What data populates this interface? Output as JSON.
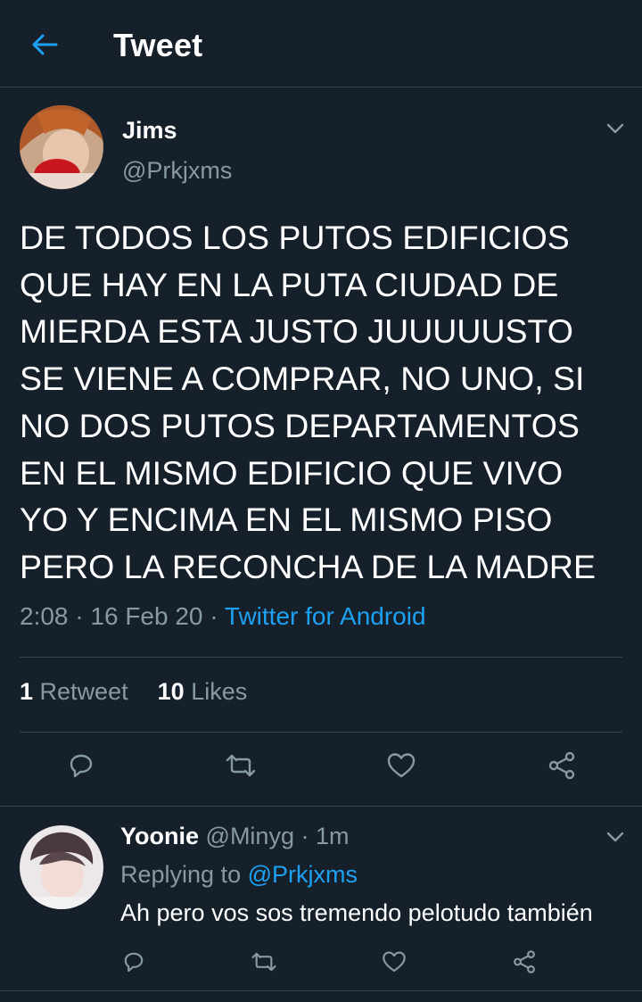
{
  "header": {
    "title": "Tweet"
  },
  "tweet": {
    "name": "Jims",
    "handle": "@Prkjxms",
    "text": "DE TODOS LOS PUTOS EDIFICIOS\nQUE HAY EN LA PUTA CIUDAD DE\nMIERDA ESTA JUSTO JUUUUUSTO\nSE VIENE A COMPRAR, NO UNO, SI\nNO DOS PUTOS DEPARTAMENTOS\nEN EL MISMO EDIFICIO QUE VIVO\nYO Y ENCIMA EN EL MISMO PISO\nPERO LA RECONCHA DE LA MADRE",
    "time": "2:08",
    "date": "16 Feb 20",
    "source": "Twitter for Android",
    "retweet_count": "1",
    "retweet_label": "Retweet",
    "like_count": "10",
    "like_label": "Likes"
  },
  "reply": {
    "name": "Yoonie",
    "handle": "@Minyg",
    "age": "1m",
    "replying_prefix": "Replying to",
    "replying_to": "@Prkjxms",
    "text": "Ah pero vos sos tremendo pelotudo también"
  },
  "colors": {
    "background": "#15202b",
    "accent": "#1da1f2",
    "muted": "#8899a6",
    "divider": "#38444d"
  },
  "icons": [
    "back-arrow-icon",
    "chevron-down-icon",
    "reply-icon",
    "retweet-icon",
    "like-icon",
    "share-icon"
  ]
}
